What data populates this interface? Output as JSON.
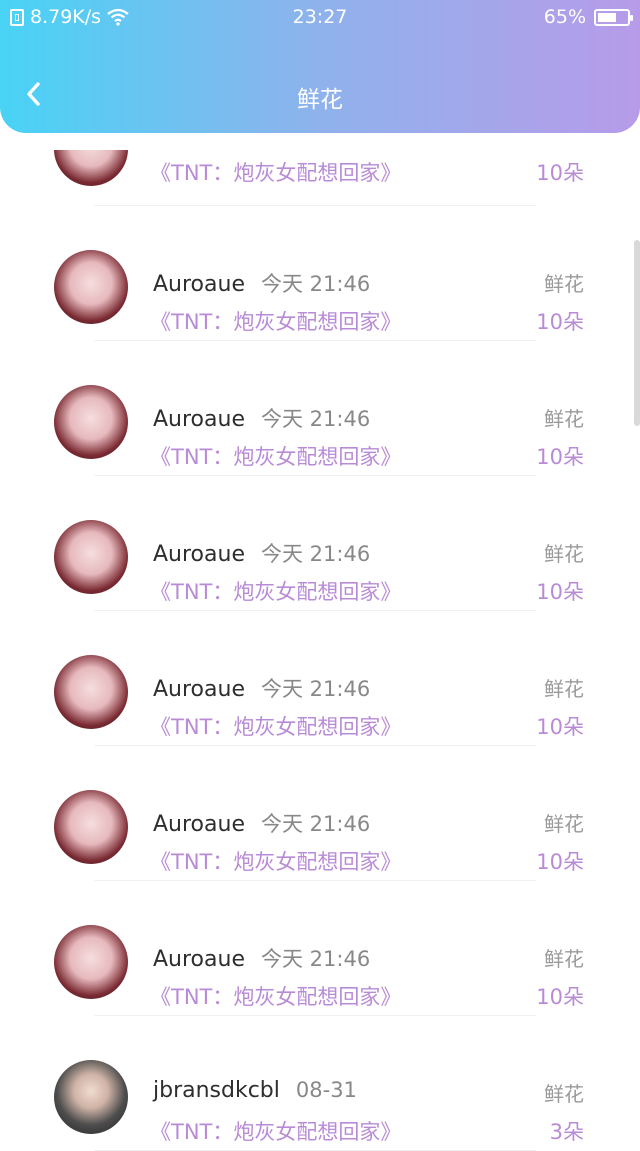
{
  "status_bar": {
    "network_speed": "8.79K/s",
    "time": "23:27",
    "battery_pct": "65%",
    "battery_level": 0.65
  },
  "header": {
    "back_icon": "chevron-left-icon",
    "title": "鲜花"
  },
  "first_row": {
    "book": "《TNT：炮灰女配想回家》",
    "count": "10朵"
  },
  "items": [
    {
      "user": "Auroaue",
      "time": "今天 21:46",
      "gift": "鲜花",
      "book": "《TNT：炮灰女配想回家》",
      "count": "10朵"
    },
    {
      "user": "Auroaue",
      "time": "今天 21:46",
      "gift": "鲜花",
      "book": "《TNT：炮灰女配想回家》",
      "count": "10朵"
    },
    {
      "user": "Auroaue",
      "time": "今天 21:46",
      "gift": "鲜花",
      "book": "《TNT：炮灰女配想回家》",
      "count": "10朵"
    },
    {
      "user": "Auroaue",
      "time": "今天 21:46",
      "gift": "鲜花",
      "book": "《TNT：炮灰女配想回家》",
      "count": "10朵"
    },
    {
      "user": "Auroaue",
      "time": "今天 21:46",
      "gift": "鲜花",
      "book": "《TNT：炮灰女配想回家》",
      "count": "10朵"
    },
    {
      "user": "Auroaue",
      "time": "今天 21:46",
      "gift": "鲜花",
      "book": "《TNT：炮灰女配想回家》",
      "count": "10朵"
    },
    {
      "user": "jbransdkcbl",
      "time": "08-31",
      "gift": "鲜花",
      "book": "《TNT：炮灰女配想回家》",
      "count": "3朵"
    }
  ],
  "colors": {
    "gradient_start": "#48d3f5",
    "gradient_end": "#b79be9",
    "accent_purple": "#b98bd6"
  }
}
